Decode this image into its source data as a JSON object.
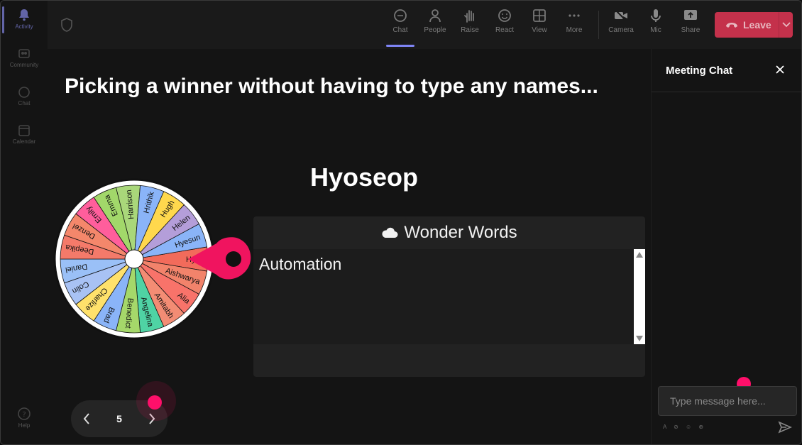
{
  "rail": {
    "items": [
      {
        "label": "Activity"
      },
      {
        "label": "Community"
      },
      {
        "label": "Chat"
      },
      {
        "label": "Calendar"
      },
      {
        "label": "Help"
      }
    ]
  },
  "toolbar": {
    "chat": "Chat",
    "people": "People",
    "raise": "Raise",
    "react": "React",
    "view": "View",
    "more": "More",
    "camera": "Camera",
    "mic": "Mic",
    "share": "Share",
    "leave": "Leave"
  },
  "stage": {
    "title": "Picking a winner without having to type any names...",
    "winner": "Hyoseop",
    "wheel_names": [
      "Hyos",
      "Aishwarya",
      "Alia",
      "Amitabh",
      "Angelina",
      "Benedict",
      "Brad",
      "Charlize",
      "Colin",
      "Daniel",
      "Deepika",
      "Denzel",
      "Emily",
      "Emma",
      "Harrison",
      "Hrithik",
      "Hugh",
      "Helen",
      "Hyesun"
    ],
    "wheel_colors": [
      "#f26b5b",
      "#f2836b",
      "#f8736a",
      "#f38c74",
      "#4fd3a4",
      "#a5d86a",
      "#8ab4f8",
      "#ffe16b",
      "#a8c2f4",
      "#9ac0f7",
      "#f47a6a",
      "#f4876b",
      "#ff5e9c",
      "#a2d86a",
      "#a9d77a",
      "#8ab4f8",
      "#ffd84d",
      "#b49ed9",
      "#8ab4f8"
    ],
    "panel_title": "Wonder Words",
    "word": "Automation",
    "page_number": "5",
    "accent": "#ff0f6a"
  },
  "chat": {
    "title": "Meeting Chat",
    "placeholder": "Type message here...",
    "tools": "A ⊘ ☺ ⊕"
  }
}
